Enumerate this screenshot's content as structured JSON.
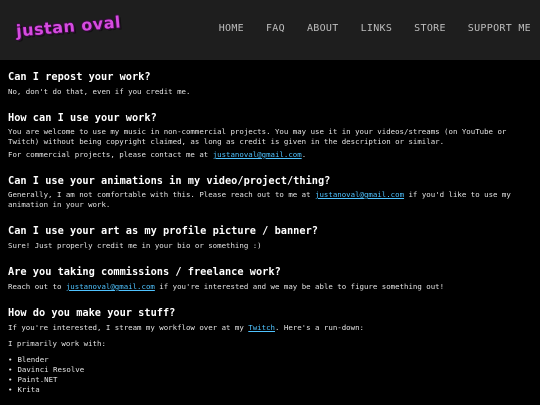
{
  "header": {
    "logo": "justan oval",
    "nav": [
      "HOME",
      "FAQ",
      "ABOUT",
      "LINKS",
      "STORE",
      "SUPPORT ME"
    ]
  },
  "faq": [
    {
      "q": "Can I repost your work?",
      "a1": "No, don't do that, even if you credit me."
    },
    {
      "q": "How can I use your work?",
      "a1": "You are welcome to use my music in non-commercial projects. You may use it in your videos/streams (on YouTube or Twitch) without being copyright claimed, as long as credit is given in the description or similar.",
      "a2_pre": "For commercial projects, please contact me at ",
      "a2_link": "justanoval@gmail.com",
      "a2_post": "."
    },
    {
      "q": "Can I use your animations in my video/project/thing?",
      "a1_pre": "Generally, I am not comfortable with this. Please reach out to me at ",
      "a1_link": "justanoval@gmail.com",
      "a1_post": " if you'd like to use my animation in your work."
    },
    {
      "q": "Can I use your art as my profile picture / banner?",
      "a1": "Sure! Just properly credit me in your bio or something :)"
    },
    {
      "q": "Are you taking commissions / freelance work?",
      "a1_pre": "Reach out to ",
      "a1_link": "justanoval@gmail.com",
      "a1_post": " if you're interested and we may be able to figure something out!"
    },
    {
      "q": "How do you make your stuff?",
      "a1_pre": "If you're interested, I stream my workflow over at my ",
      "a1_link": "Twitch",
      "a1_post": ". Here's a run-down:",
      "a2": "I primarily work with:",
      "tools": [
        "Blender",
        "Davinci Resolve",
        "Paint.NET",
        "Krita"
      ]
    }
  ],
  "colors": {
    "link": "#4fc3ff",
    "logo": "#d64be0",
    "header_bg": "#1e1e1e"
  }
}
